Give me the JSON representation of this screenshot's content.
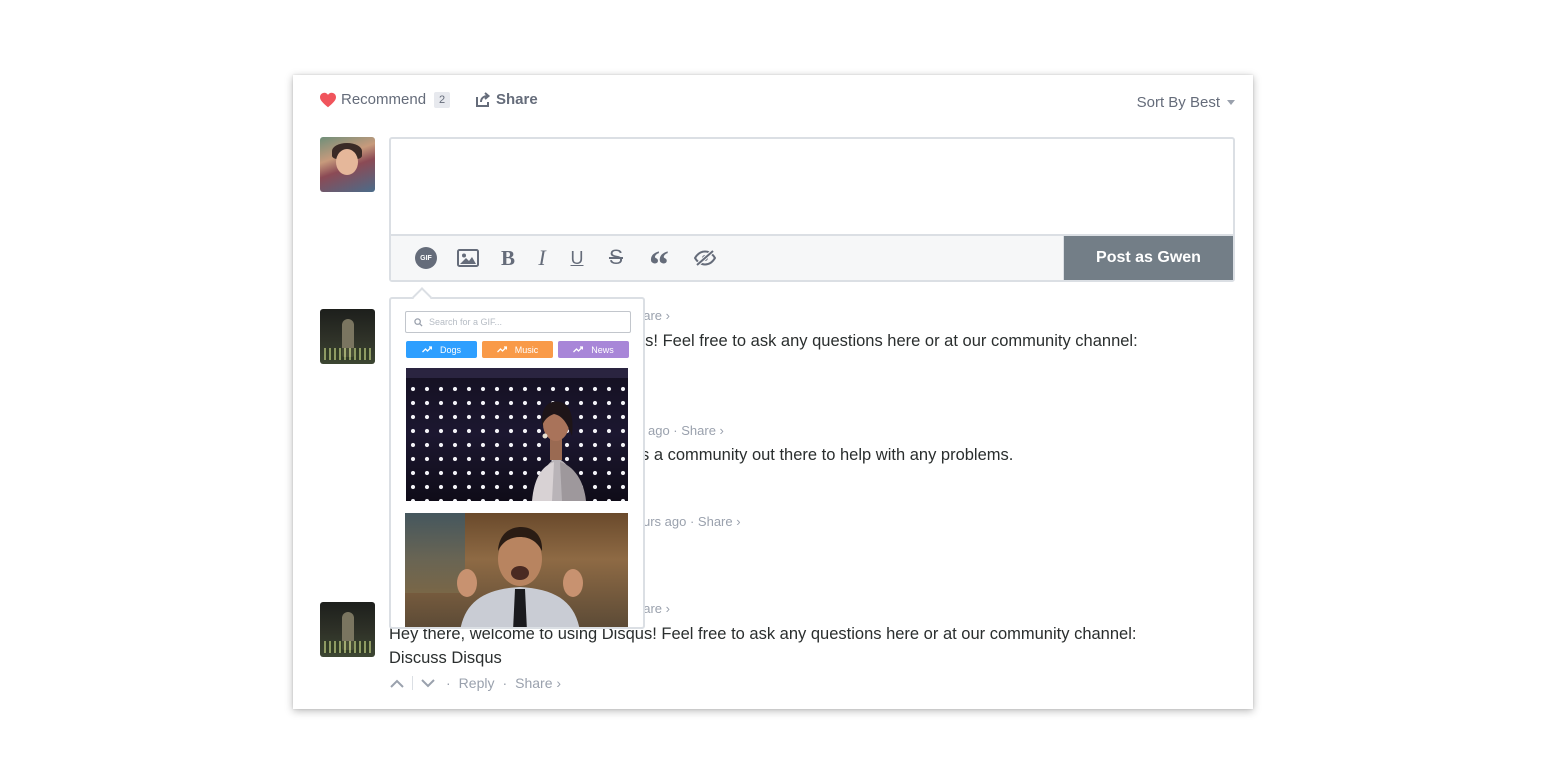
{
  "topbar": {
    "recommend_label": "Recommend",
    "recommend_count": "2",
    "share_label": "Share",
    "sort_label": "Sort By Best"
  },
  "editor": {
    "placeholder": "",
    "post_button": "Post as Gwen",
    "tools": [
      "gif-icon",
      "image-icon",
      "bold-icon",
      "italic-icon",
      "underline-icon",
      "strikethrough-icon",
      "quote-icon",
      "spoiler-icon"
    ],
    "tool_glyphs": {
      "gif": "GIF",
      "bold": "B",
      "italic": "I",
      "underline": "U",
      "strike": "S",
      "quote": "“"
    }
  },
  "gif_picker": {
    "search_placeholder": "Search for a GIF...",
    "tags": [
      {
        "label": "Dogs",
        "color": "#2e9fff"
      },
      {
        "label": "Music",
        "color": "#f99a48"
      },
      {
        "label": "News",
        "color": "#a886d8"
      }
    ]
  },
  "comments": [
    {
      "meta": "hare ›",
      "text": "us! Feel free to ask any questions here or at our community channel:"
    },
    {
      "meta": "ago  ·  Share ›",
      "text": "s a community out there to help with any problems."
    },
    {
      "meta": "urs ago  ·  Share ›",
      "text": ""
    },
    {
      "meta": "hare ›",
      "text": "Hey there, welcome to using Disqus! Feel free to ask any questions here or at our community channel:",
      "text_line2": "Discuss Disqus",
      "reply_label": "Reply",
      "share_label": "Share ›"
    }
  ],
  "colors": {
    "accent_heart": "#f0545c",
    "text_muted": "#656c7a",
    "post_button_bg": "#737e87"
  }
}
